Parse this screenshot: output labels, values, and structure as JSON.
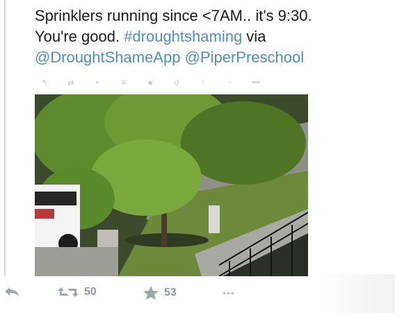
{
  "tweet": {
    "line1": "Sprinklers running since <7AM.. it's 9:30.",
    "line2_text": "You're good. ",
    "hashtag": "#droughtshaming",
    "line2_tail": " via",
    "mention1": "@DroughtShameApp",
    "mention2": "@PiperPreschool"
  },
  "inner_actions": [
    "reply-icon",
    "retweet-icon",
    "favorite-icon",
    "pin-icon",
    "star-icon",
    "more-icon"
  ],
  "actions": {
    "retweet_count": "50",
    "favorite_count": "53",
    "more_label": "•••"
  },
  "colors": {
    "link": "#4f8fc0",
    "action_gray": "#9aa7b3",
    "text": "#1a1a1a"
  }
}
